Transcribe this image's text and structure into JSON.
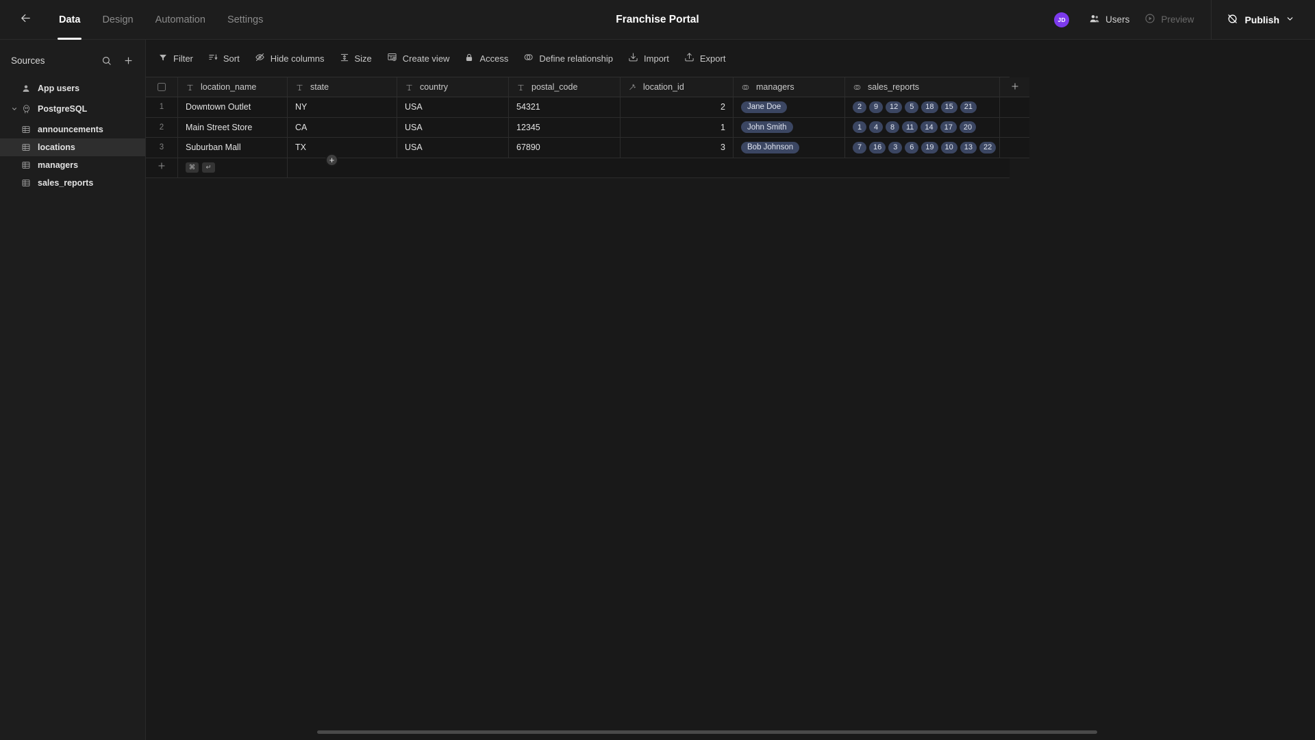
{
  "header": {
    "back_icon": "arrow-left-icon",
    "app_title": "Franchise Portal",
    "tabs": [
      {
        "label": "Data",
        "active": true
      },
      {
        "label": "Design",
        "active": false
      },
      {
        "label": "Automation",
        "active": false
      },
      {
        "label": "Settings",
        "active": false
      }
    ],
    "avatar_initials": "JD",
    "avatar_color": "#7c3aed",
    "users_label": "Users",
    "preview_label": "Preview",
    "publish_label": "Publish"
  },
  "sidebar": {
    "title": "Sources",
    "search_icon": "search-icon",
    "add_icon": "plus-icon",
    "items": [
      {
        "label": "App users",
        "icon": "user-icon",
        "level": 0,
        "selected": false,
        "caret": ""
      },
      {
        "label": "PostgreSQL",
        "icon": "postgres-icon",
        "level": 0,
        "selected": false,
        "caret": "chevron-down-icon"
      },
      {
        "label": "announcements",
        "icon": "table-icon",
        "level": 1,
        "selected": false,
        "caret": ""
      },
      {
        "label": "locations",
        "icon": "table-icon",
        "level": 1,
        "selected": true,
        "caret": ""
      },
      {
        "label": "managers",
        "icon": "table-icon",
        "level": 1,
        "selected": false,
        "caret": ""
      },
      {
        "label": "sales_reports",
        "icon": "table-icon",
        "level": 1,
        "selected": false,
        "caret": ""
      }
    ]
  },
  "toolbar": {
    "items": [
      {
        "label": "Filter",
        "icon": "filter-icon"
      },
      {
        "label": "Sort",
        "icon": "sort-icon"
      },
      {
        "label": "Hide columns",
        "icon": "eye-off-icon"
      },
      {
        "label": "Size",
        "icon": "row-height-icon"
      },
      {
        "label": "Create view",
        "icon": "grid-add-icon"
      },
      {
        "label": "Access",
        "icon": "lock-icon"
      },
      {
        "label": "Define relationship",
        "icon": "relationship-icon"
      },
      {
        "label": "Import",
        "icon": "import-icon"
      },
      {
        "label": "Export",
        "icon": "export-icon"
      }
    ]
  },
  "table": {
    "select_all_icon": "checkbox-icon",
    "add_column_icon": "plus-icon",
    "add_row_icon": "plus-icon",
    "add_row_shortcut": [
      "⌘",
      "↵"
    ],
    "columns": [
      {
        "name": "location_name",
        "type_icon": "text-type-icon"
      },
      {
        "name": "state",
        "type_icon": "text-type-icon"
      },
      {
        "name": "country",
        "type_icon": "text-type-icon"
      },
      {
        "name": "postal_code",
        "type_icon": "text-type-icon"
      },
      {
        "name": "location_id",
        "type_icon": "autonumber-type-icon"
      },
      {
        "name": "managers",
        "type_icon": "relation-type-icon"
      },
      {
        "name": "sales_reports",
        "type_icon": "relation-type-icon"
      }
    ],
    "rows": [
      {
        "index": "1",
        "location_name": "Downtown Outlet",
        "state": "NY",
        "country": "USA",
        "postal_code": "54321",
        "location_id": "2",
        "managers": "Jane Doe",
        "sales_reports": [
          "2",
          "9",
          "12",
          "5",
          "18",
          "15",
          "21"
        ]
      },
      {
        "index": "2",
        "location_name": "Main Street Store",
        "state": "CA",
        "country": "USA",
        "postal_code": "12345",
        "location_id": "1",
        "managers": "John Smith",
        "sales_reports": [
          "1",
          "4",
          "8",
          "11",
          "14",
          "17",
          "20"
        ]
      },
      {
        "index": "3",
        "location_name": "Suburban Mall",
        "state": "TX",
        "country": "USA",
        "postal_code": "67890",
        "location_id": "3",
        "managers": "Bob Johnson",
        "sales_reports": [
          "7",
          "16",
          "3",
          "6",
          "19",
          "10",
          "13",
          "22"
        ]
      }
    ]
  },
  "colors": {
    "accent": "#7c3aed",
    "chip_bg": "#3b4662",
    "chip_fg": "#dfe4ef",
    "page_bg": "#191919",
    "panel_bg": "#1d1d1d"
  }
}
